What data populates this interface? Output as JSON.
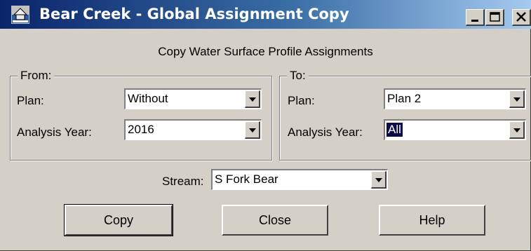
{
  "window": {
    "title": "Bear Creek - Global Assignment Copy",
    "controls": {
      "minimize_icon": "minimize-icon",
      "maximize_icon": "maximize-icon",
      "close_icon": "close-icon"
    }
  },
  "dialog": {
    "heading": "Copy Water Surface Profile Assignments",
    "from": {
      "legend": "From:",
      "plan_label": "Plan:",
      "plan_value": "Without",
      "year_label": "Analysis Year:",
      "year_value": "2016"
    },
    "to": {
      "legend": "To:",
      "plan_label": "Plan:",
      "plan_value": "Plan 2",
      "year_label": "Analysis Year:",
      "year_value": "All"
    },
    "stream": {
      "label": "Stream:",
      "value": "S Fork Bear"
    },
    "buttons": {
      "copy": "Copy",
      "close": "Close",
      "help": "Help"
    }
  }
}
